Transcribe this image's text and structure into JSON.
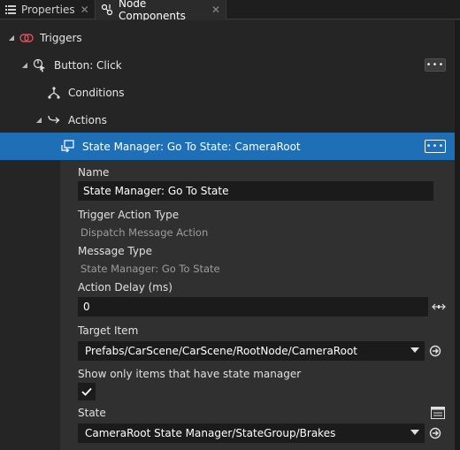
{
  "tabs": [
    {
      "label": "Properties",
      "icon": "list-icon"
    },
    {
      "label": "Node Components",
      "icon": "node-components-icon"
    }
  ],
  "tree": {
    "triggers_label": "Triggers",
    "button_click_label": "Button: Click",
    "conditions_label": "Conditions",
    "actions_label": "Actions",
    "selected_action_label": "State Manager: Go To State: CameraRoot",
    "more_label": "•••"
  },
  "details": {
    "name_label": "Name",
    "name_value": "State Manager: Go To State",
    "trigger_action_type_label": "Trigger Action Type",
    "trigger_action_type_value": "Dispatch Message Action",
    "message_type_label": "Message Type",
    "message_type_value": "State Manager: Go To State",
    "action_delay_label": "Action Delay (ms)",
    "action_delay_value": "0",
    "target_item_label": "Target Item",
    "target_item_value": "Prefabs/CarScene/CarScene/RootNode/CameraRoot",
    "show_only_label": "Show only items that have state manager",
    "show_only_checked": true,
    "state_label": "State",
    "state_value": "CameraRoot State Manager/StateGroup/Brakes"
  },
  "colors": {
    "selection": "#1f6fb6",
    "trigger_icon": "#e0505a"
  }
}
